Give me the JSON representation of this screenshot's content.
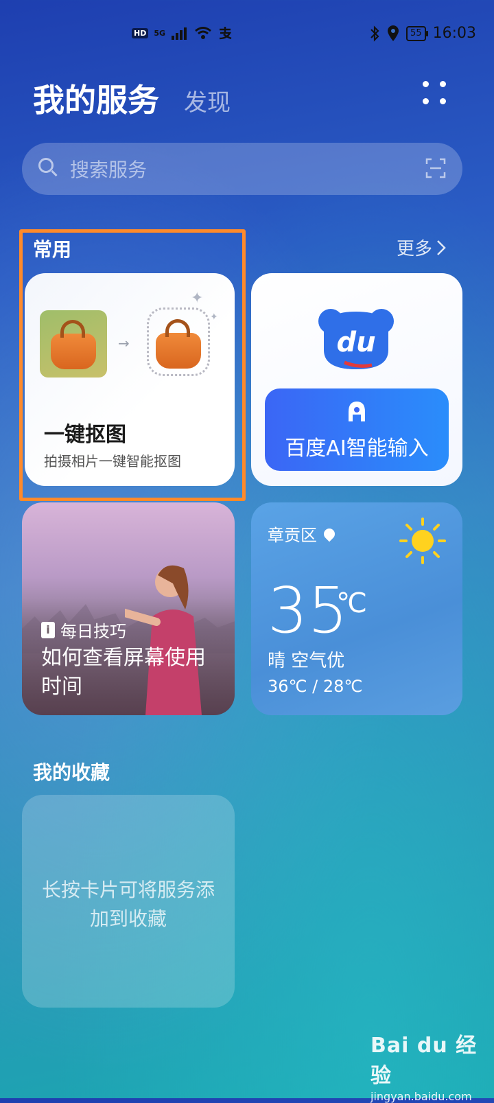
{
  "status_bar": {
    "hd": "HD",
    "network": "5G",
    "time": "16:03",
    "battery": "55"
  },
  "header": {
    "title": "我的服务",
    "tab_discover": "发现"
  },
  "search": {
    "placeholder": "搜索服务"
  },
  "common": {
    "title": "常用",
    "more": "更多"
  },
  "cutout_card": {
    "title": "一键抠图",
    "subtitle": "拍摄相片一键智能抠图"
  },
  "baidu_card": {
    "logo_text": "du",
    "button_label": "百度AI智能输入"
  },
  "tips_card": {
    "tag": "每日技巧",
    "text": "如何查看屏幕使用时间"
  },
  "weather_card": {
    "location": "章贡区",
    "temperature": "35",
    "unit": "℃",
    "condition": "晴 空气优",
    "range": "36℃ / 28℃"
  },
  "favorites": {
    "title": "我的收藏",
    "hint": "长按卡片可将服务添加到收藏"
  },
  "watermark": {
    "main": "Bai du 经验",
    "sub": "jingyan.baidu.com"
  },
  "colors": {
    "highlight": "#ff8a2a",
    "baidu_blue": "#3b66f5"
  }
}
